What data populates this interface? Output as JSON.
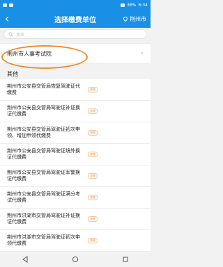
{
  "statusbar": {
    "battery": "36%",
    "time": "6:34"
  },
  "header": {
    "back_icon": "chevron-left-icon",
    "title": "选择缴费单位",
    "city": "荆州市"
  },
  "search": {
    "placeholder": "搜索"
  },
  "featured": {
    "label": "荆州市人事考试院"
  },
  "section": {
    "label": "其他"
  },
  "items": [
    {
      "name": "荆州市公安县交管局恢复驾驶证代缴费",
      "tag": "非税"
    },
    {
      "name": "荆州市公安县交管局驾驶证补证换证代缴费",
      "tag": "非税"
    },
    {
      "name": "荆州市公安县交管局驾驶证初次申领、增加申领代缴费",
      "tag": "非税"
    },
    {
      "name": "荆州市公安县交管局驾驶证境外换证代缴费",
      "tag": "非税"
    },
    {
      "name": "荆州市公安县交管局驾驶证军警换证代缴费",
      "tag": "非税"
    },
    {
      "name": "荆州市公安县交管局驾驶证满分考试代缴费",
      "tag": "非税"
    },
    {
      "name": "荆州市洪湖市交管局驾驶证补证换证代缴费",
      "tag": "非税"
    },
    {
      "name": "荆州市洪湖市交管局驾驶证初次申领代缴费",
      "tag": "非税"
    }
  ],
  "colors": {
    "primary": "#1a8fe6",
    "highlight_ring": "#f08a2c",
    "tag": "#e39a4e"
  }
}
